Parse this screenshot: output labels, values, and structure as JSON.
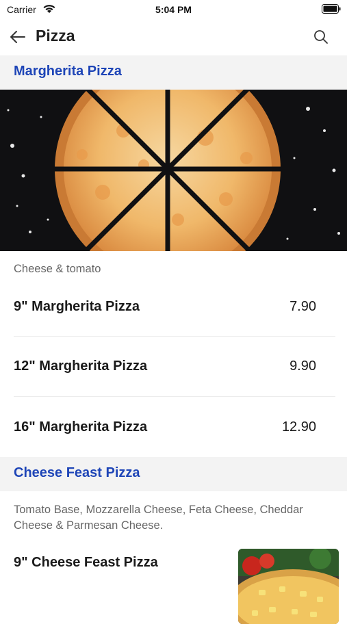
{
  "status_bar": {
    "carrier": "Carrier",
    "time": "5:04 PM"
  },
  "nav": {
    "title": "Pizza",
    "back_icon": "arrow-left-icon",
    "search_icon": "search-icon"
  },
  "sections": [
    {
      "title": "Margherita Pizza",
      "description": "Cheese & tomato",
      "items": [
        {
          "name": "9\" Margherita Pizza",
          "price": "7.90"
        },
        {
          "name": "12\" Margherita Pizza",
          "price": "9.90"
        },
        {
          "name": "16\" Margherita Pizza",
          "price": "12.90"
        }
      ]
    },
    {
      "title": "Cheese Feast Pizza",
      "description": "Tomato Base, Mozzarella Cheese, Feta Cheese, Cheddar Cheese & Parmesan Cheese.",
      "items": [
        {
          "name": "9\" Cheese Feast Pizza"
        }
      ]
    }
  ],
  "colors": {
    "accent": "#1e45b7",
    "header_bg": "#f3f3f3"
  }
}
